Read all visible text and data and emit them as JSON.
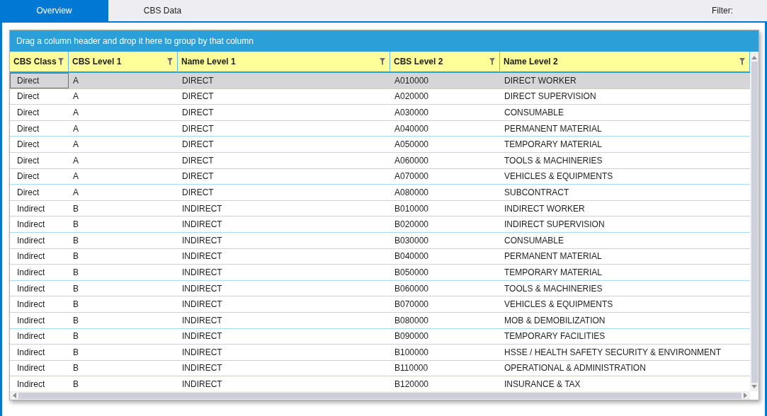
{
  "tabs": [
    {
      "label": "Overview",
      "selected": true
    },
    {
      "label": "CBS Data",
      "selected": false
    }
  ],
  "filter": {
    "label": "Filter:"
  },
  "grid": {
    "group_panel": "Drag a column header and drop it here to group by that column",
    "columns": [
      "CBS Class",
      "CBS Level 1",
      "Name Level 1",
      "CBS Level 2",
      "Name Level 2"
    ],
    "rows": [
      {
        "cells": [
          "Direct",
          "A",
          "DIRECT",
          "A010000",
          "DIRECT WORKER"
        ],
        "selected": true
      },
      {
        "cells": [
          "Direct",
          "A",
          "DIRECT",
          "A020000",
          "DIRECT SUPERVISION"
        ],
        "selected": false
      },
      {
        "cells": [
          "Direct",
          "A",
          "DIRECT",
          "A030000",
          "CONSUMABLE"
        ],
        "selected": false
      },
      {
        "cells": [
          "Direct",
          "A",
          "DIRECT",
          "A040000",
          "PERMANENT MATERIAL"
        ],
        "selected": false
      },
      {
        "cells": [
          "Direct",
          "A",
          "DIRECT",
          "A050000",
          "TEMPORARY MATERIAL"
        ],
        "selected": false
      },
      {
        "cells": [
          "Direct",
          "A",
          "DIRECT",
          "A060000",
          "TOOLS & MACHINERIES"
        ],
        "selected": false
      },
      {
        "cells": [
          "Direct",
          "A",
          "DIRECT",
          "A070000",
          "VEHICLES & EQUIPMENTS"
        ],
        "selected": false
      },
      {
        "cells": [
          "Direct",
          "A",
          "DIRECT",
          "A080000",
          "SUBCONTRACT"
        ],
        "selected": false
      },
      {
        "cells": [
          "Indirect",
          "B",
          "INDIRECT",
          "B010000",
          "INDIRECT WORKER"
        ],
        "selected": false
      },
      {
        "cells": [
          "Indirect",
          "B",
          "INDIRECT",
          "B020000",
          "INDIRECT SUPERVISION"
        ],
        "selected": false
      },
      {
        "cells": [
          "Indirect",
          "B",
          "INDIRECT",
          "B030000",
          "CONSUMABLE"
        ],
        "selected": false
      },
      {
        "cells": [
          "Indirect",
          "B",
          "INDIRECT",
          "B040000",
          "PERMANENT MATERIAL"
        ],
        "selected": false
      },
      {
        "cells": [
          "Indirect",
          "B",
          "INDIRECT",
          "B050000",
          "TEMPORARY MATERIAL"
        ],
        "selected": false
      },
      {
        "cells": [
          "Indirect",
          "B",
          "INDIRECT",
          "B060000",
          "TOOLS & MACHINERIES"
        ],
        "selected": false
      },
      {
        "cells": [
          "Indirect",
          "B",
          "INDIRECT",
          "B070000",
          "VEHICLES & EQUIPMENTS"
        ],
        "selected": false
      },
      {
        "cells": [
          "Indirect",
          "B",
          "INDIRECT",
          "B080000",
          "MOB & DEMOBILIZATION"
        ],
        "selected": false
      },
      {
        "cells": [
          "Indirect",
          "B",
          "INDIRECT",
          "B090000",
          "TEMPORARY FACILITIES"
        ],
        "selected": false
      },
      {
        "cells": [
          "Indirect",
          "B",
          "INDIRECT",
          "B100000",
          "HSSE / HEALTH SAFETY SECURITY & ENVIRONMENT"
        ],
        "selected": false
      },
      {
        "cells": [
          "Indirect",
          "B",
          "INDIRECT",
          "B110000",
          "OPERATIONAL & ADMINISTRATION"
        ],
        "selected": false
      },
      {
        "cells": [
          "Indirect",
          "B",
          "INDIRECT",
          "B120000",
          "INSURANCE & TAX"
        ],
        "selected": false
      }
    ]
  }
}
